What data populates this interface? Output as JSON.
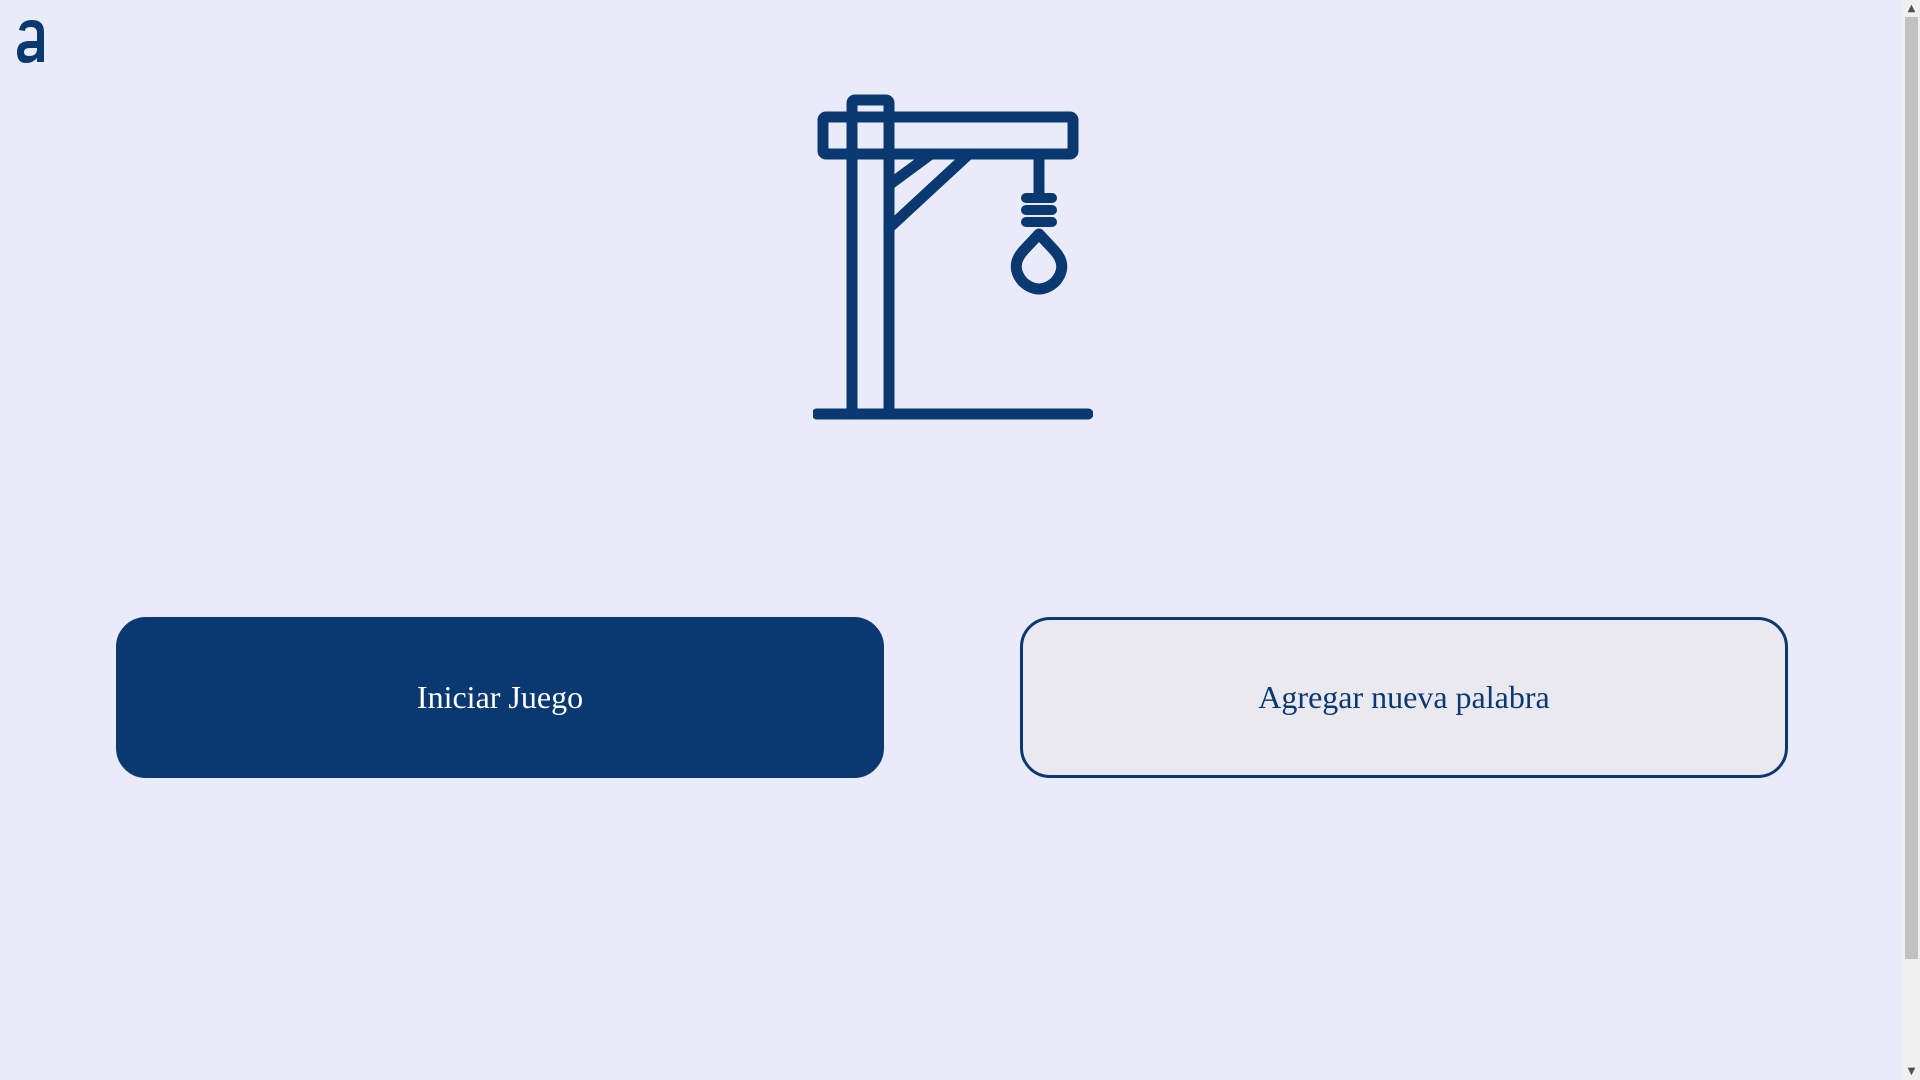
{
  "colors": {
    "background": "#E9ECF8",
    "primary": "#0A3871",
    "secondary_bg": "#E9E9EF",
    "on_primary": "#FFFFFF"
  },
  "header": {
    "logo_icon": "alura-a-logo-icon"
  },
  "illustration": {
    "icon": "gallows-icon"
  },
  "actions": {
    "start_label": "Iniciar Juego",
    "add_word_label": "Agregar nueva palabra"
  },
  "scrollbar": {
    "up_icon": "▲",
    "down_icon": "▼"
  }
}
